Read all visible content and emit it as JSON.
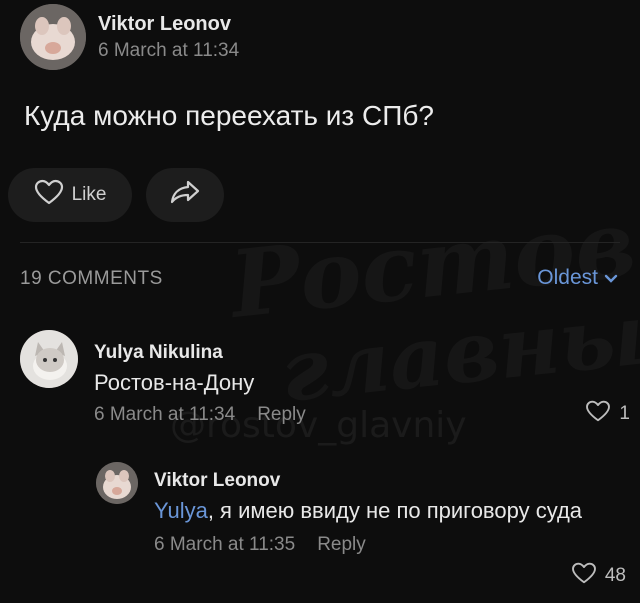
{
  "post": {
    "author": "Viktor Leonov",
    "date": "6 March at 11:34",
    "text": "Куда можно переехать из СПб?",
    "like_label": "Like"
  },
  "comments_header": {
    "count_label": "19 COMMENTS",
    "sort_label": "Oldest"
  },
  "comments": [
    {
      "author": "Yulya Nikulina",
      "text": "Ростов-на-Дону",
      "date": "6 March at 11:34",
      "reply_label": "Reply",
      "likes": "1"
    },
    {
      "author": "Viktor Leonov",
      "mention": "Yulya",
      "text": ", я имею ввиду не по приговору суда",
      "date": "6 March at 11:35",
      "reply_label": "Reply",
      "likes": "48"
    }
  ],
  "watermark": {
    "line1": "Ростов",
    "line2": "главный",
    "line3": "@rostov_glavniy"
  },
  "colors": {
    "background": "#0d0d0d",
    "accent": "#6a96d8",
    "muted": "#8a8a8a"
  },
  "icons": [
    "heart-icon",
    "share-icon",
    "chevron-down-icon"
  ]
}
